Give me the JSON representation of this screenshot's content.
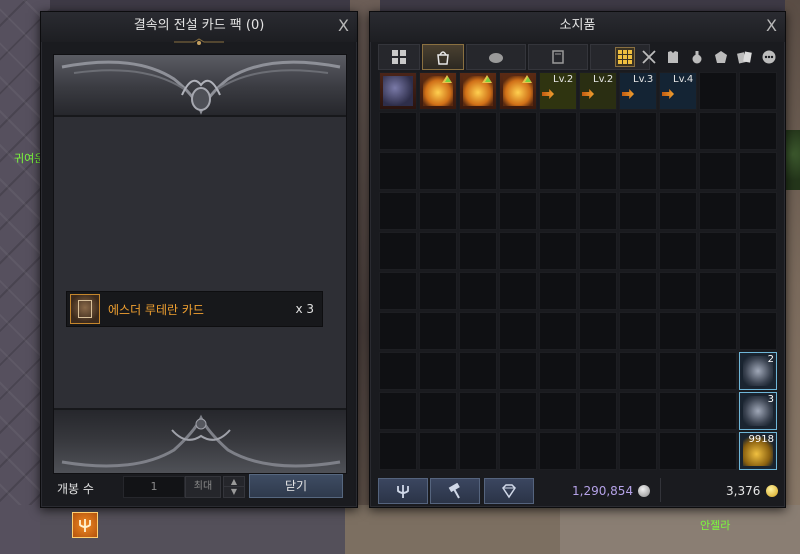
{
  "npc_labels": {
    "left": "귀여운",
    "right": "안젤라"
  },
  "card_pack": {
    "title": "결속의 전설 카드 팩 (0)",
    "close_glyph": "X",
    "card": {
      "name": "에스더 루테란 카드",
      "quantity": "x 3"
    },
    "open_count_label": "개봉 수",
    "open_count_value": "1",
    "max_label": "최대",
    "stepper_up": "▲",
    "stepper_down": "▼",
    "close_button": "닫기"
  },
  "inventory": {
    "title": "소지품",
    "close_glyph": "X",
    "tabs": [
      {
        "icon": "grid-icon",
        "active": false
      },
      {
        "icon": "bag-icon",
        "active": true
      },
      {
        "icon": "pouch-icon",
        "active": false
      },
      {
        "icon": "book-icon",
        "active": false
      },
      {
        "icon": "bomb-icon",
        "active": false
      }
    ],
    "filters": [
      "grid-icon",
      "crossed-swords-icon",
      "armor-icon",
      "potion-icon",
      "gem-icon",
      "cards-icon",
      "more-icon"
    ],
    "slots_row1": [
      {
        "type": "ore",
        "label": ""
      },
      {
        "type": "box",
        "label": ""
      },
      {
        "type": "box",
        "label": ""
      },
      {
        "type": "box",
        "label": ""
      },
      {
        "type": "lv",
        "label": "Lv.2"
      },
      {
        "type": "lv",
        "label": "Lv.2"
      },
      {
        "type": "lv",
        "label": "Lv.3"
      },
      {
        "type": "lv",
        "label": "Lv.4"
      }
    ],
    "stack_slots": [
      {
        "row": 7,
        "count": "2"
      },
      {
        "row": 8,
        "count": "3"
      },
      {
        "row": 9,
        "count": "9918"
      }
    ],
    "silver": "1,290,854",
    "gold": "3,376",
    "colors": {
      "silver_text": "#b5a2e8",
      "accent": "#8a7040",
      "legendary_orange": "#f0a030"
    }
  }
}
